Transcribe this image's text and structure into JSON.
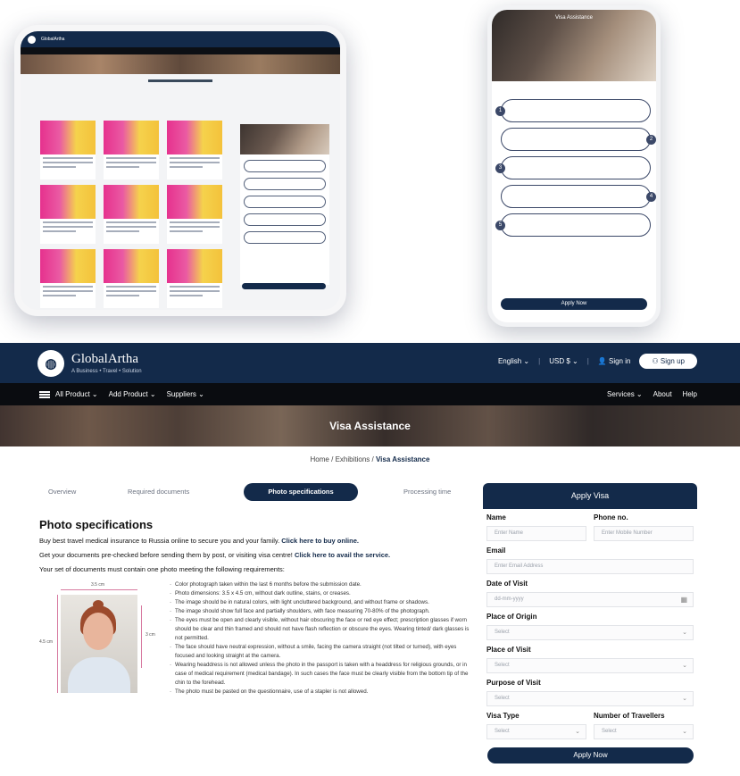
{
  "phone": {
    "hero_title": "Visa Assistance",
    "button": "Apply Now",
    "steps": [
      "1",
      "2",
      "3",
      "4",
      "5"
    ]
  },
  "nav": {
    "brand": "GlobalArtha",
    "tagline": "A Business • Travel • Solution",
    "language": "English ⌄",
    "currency": "USD $ ⌄",
    "signin": "Sign in",
    "signup": "Sign up"
  },
  "subnav": {
    "all_product": "All Product ⌄",
    "add_product": "Add Product ⌄",
    "suppliers": "Suppliers ⌄",
    "services": "Services ⌄",
    "about": "About",
    "help": "Help"
  },
  "hero": {
    "title": "Visa Assistance"
  },
  "breadcrumb": {
    "home": "Home",
    "exhibitions": "Exhibitions",
    "current": "Visa Assistance",
    "sep": "/"
  },
  "tabs": [
    "Overview",
    "Required documents",
    "Photo specifications",
    "Processing time"
  ],
  "content": {
    "title": "Photo specifications",
    "p1": "Buy best travel medical insurance to Russia online to secure you and your family.",
    "p1_link": "Click here to buy online.",
    "p2": "Get your documents pre-checked before sending them by post, or visiting visa centre!",
    "p2_link": "Click here to avail the service.",
    "p3": "Your set of documents must contain one photo meeting the following requirements:",
    "dim_top": "3.5 cm",
    "dim_left": "4.5 cm",
    "dim_face": "3 cm",
    "bullets": [
      "Color photograph taken within the last 6 months before the submission date.",
      "Photo dimensions: 3.5 x 4.5 cm, without dark outline, stains, or creases.",
      "The image should be in natural colors, with light uncluttered background, and without frame or shadows.",
      "The image should show full face and partially shoulders, with face measuring 70-80% of the photograph.",
      "The eyes must be open and clearly visible, without hair obscuring the face or red eye effect; prescription glasses if worn should be clear and thin framed and should not have flash reflection or obscure the eyes. Wearing tinted/ dark glasses is not permitted.",
      "The face should have neutral expression, without a smile, facing the camera straight (not tilted or turned), with eyes focused and looking straight at the camera.",
      "Wearing headdress is not allowed unless the photo in the passport is taken with a headdress for religious grounds, or in case of medical requirement (medical bandage). In such cases the face must be clearly visible from the bottom tip of the chin to the forehead.",
      "The photo must be pasted on the questionnaire, use of a stapler is not allowed."
    ]
  },
  "form": {
    "title": "Apply Visa",
    "name_label": "Name",
    "name_ph": "Enter Name",
    "phone_label": "Phone no.",
    "phone_ph": "Enter Mobile Number",
    "email_label": "Email",
    "email_ph": "Enter Email Address",
    "date_label": "Date of Visit",
    "date_ph": "dd-mm-yyyy",
    "origin_label": "Place of Origin",
    "origin_ph": "Select",
    "visit_label": "Place of Visit",
    "visit_ph": "Select",
    "purpose_label": "Purpose of Visit",
    "purpose_ph": "Select",
    "type_label": "Visa Type",
    "type_ph": "Select",
    "travellers_label": "Number of Travellers",
    "travellers_ph": "Select",
    "submit": "Apply Now"
  }
}
